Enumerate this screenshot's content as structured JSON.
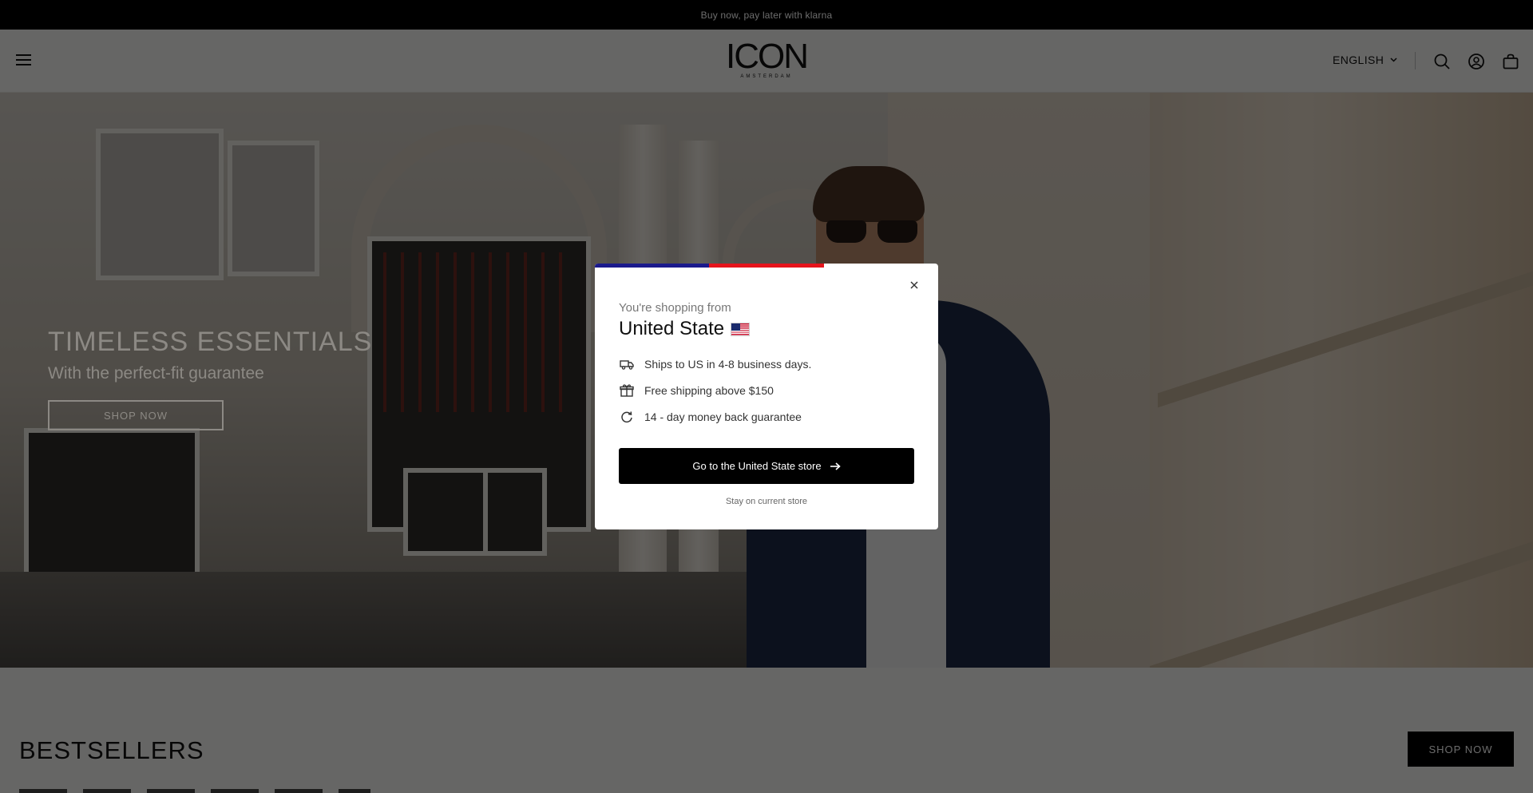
{
  "announcement": {
    "text": "Buy now, pay later with klarna"
  },
  "header": {
    "logo_main": "ICON",
    "logo_sub": "AMSTERDAM",
    "language": "ENGLISH",
    "icons": [
      "menu-icon",
      "search-icon",
      "account-icon",
      "cart-icon"
    ]
  },
  "hero": {
    "title": "TIMELESS ESSENTIALS",
    "subtitle": "With the perfect-fit guarantee",
    "button": "SHOP NOW"
  },
  "bestsellers": {
    "title": "BESTSELLERS",
    "button": "SHOP NOW"
  },
  "modal": {
    "from_label": "You're shopping from",
    "country": "United State",
    "perks": [
      {
        "icon": "truck-icon",
        "text": "Ships to US in 4-8 business days."
      },
      {
        "icon": "gift-icon",
        "text": "Free shipping above $150"
      },
      {
        "icon": "refresh-icon",
        "text": "14 - day money back guarantee"
      }
    ],
    "cta": "Go to the United State store",
    "stay": "Stay on current store",
    "flag_colors": {
      "blue": "#1b1a8c",
      "red": "#e5141c"
    }
  },
  "colors": {
    "overlay": "rgba(0,0,0,0.58)",
    "background": "#f4f3f1",
    "text": "#111111"
  }
}
